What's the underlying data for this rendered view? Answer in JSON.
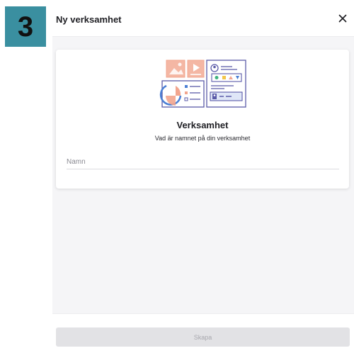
{
  "step_badge": {
    "number": "3",
    "color": "#3a8fa0"
  },
  "modal": {
    "title": "Ny verksamhet",
    "close_icon": "close-icon"
  },
  "card": {
    "illustration": "business-dashboard-illustration",
    "title": "Verksamhet",
    "subtitle": "Vad är namnet på din verksamhet",
    "name_input": {
      "placeholder": "Namn",
      "value": ""
    }
  },
  "footer": {
    "create_label": "Skapa",
    "create_enabled": false
  },
  "colors": {
    "illustration_outline": "#5a5aa8",
    "illustration_accent": "#f2a58e",
    "illustration_blue": "#4b7fd4",
    "illustration_yellow": "#f3c64a",
    "illustration_green": "#3fb37f"
  }
}
